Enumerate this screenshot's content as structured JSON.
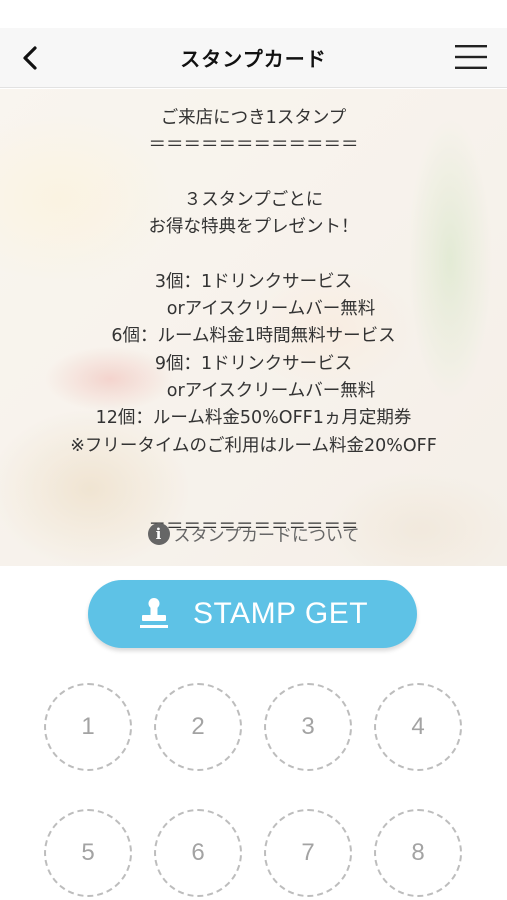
{
  "header": {
    "title": "スタンプカード",
    "back_icon": "chevron-left-icon",
    "menu_icon": "hamburger-menu-icon"
  },
  "info": {
    "lines": [
      "ご来店につき1スタンプ",
      "＝＝＝＝＝＝＝＝＝＝＝＝",
      "",
      "３スタンプごとに",
      "お得な特典をプレゼント！",
      "",
      "3個：1ドリンクサービス",
      "　　orアイスクリームバー無料",
      "6個：ルーム料金1時間無料サービス",
      "9個：1ドリンクサービス",
      "　　orアイスクリームバー無料",
      "12個：ルーム料金50%OFF1ヵ月定期券",
      "※フリータイムのご利用はルーム料金20%OFF",
      "",
      "",
      "＝＝＝＝＝＝＝＝＝＝＝＝"
    ],
    "link_label": "スタンプカードについて",
    "link_icon": "info-circle-icon"
  },
  "stamp_button": {
    "label": "STAMP GET",
    "icon": "stamp-icon",
    "color": "#5ec2e6"
  },
  "stamps": [
    "1",
    "2",
    "3",
    "4",
    "5",
    "6",
    "7",
    "8"
  ]
}
